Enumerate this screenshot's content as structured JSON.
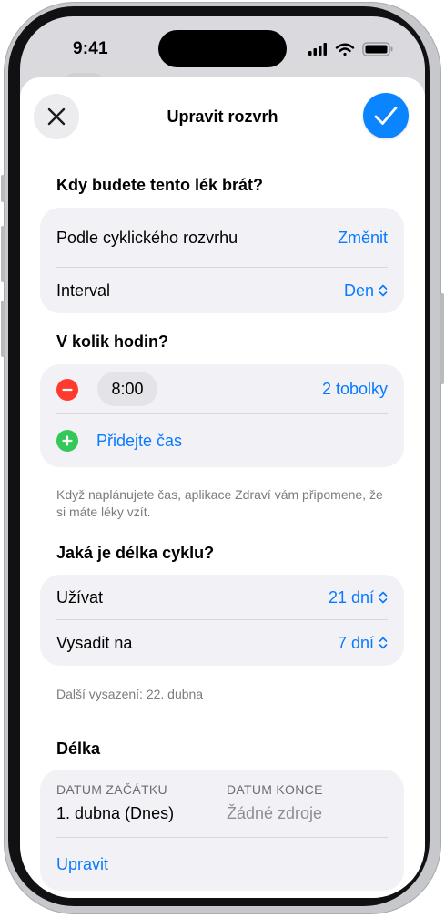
{
  "status_bar": {
    "time": "9:41"
  },
  "header": {
    "title": "Upravit rozvrh"
  },
  "schedule_section": {
    "title": "Kdy budete tento lék brát?",
    "cyclic_label": "Podle cyklického rozvrhu",
    "change_label": "Změnit",
    "interval_label": "Interval",
    "interval_value": "Den"
  },
  "times_section": {
    "title": "V kolik hodin?",
    "time_value": "8:00",
    "dose_value": "2 tobolky",
    "add_time_label": "Přidejte čas",
    "footnote": "Když naplánujete čas, aplikace Zdraví vám připomene, že si máte léky vzít."
  },
  "cycle_section": {
    "title": "Jaká je délka cyklu?",
    "take_label": "Užívat",
    "take_value": "21 dní",
    "pause_label": "Vysadit na",
    "pause_value": "7 dní",
    "footnote": "Další vysazení: 22. dubna"
  },
  "duration_section": {
    "title": "Délka",
    "start_caption": "DATUM ZAČÁTKU",
    "start_value": "1. dubna (Dnes)",
    "end_caption": "DATUM KONCE",
    "end_value": "Žádné zdroje",
    "edit_label": "Upravit"
  },
  "colors": {
    "accent": "#0a7aff",
    "confirm": "#0a84ff",
    "remove": "#ff3b30",
    "add": "#34c759"
  }
}
